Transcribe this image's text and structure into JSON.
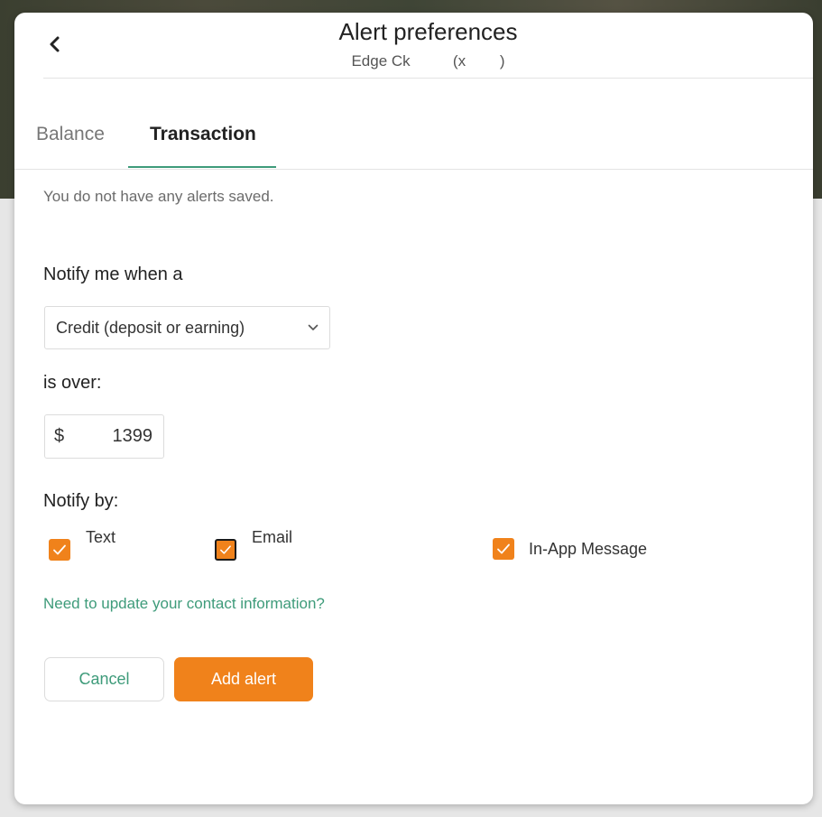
{
  "header": {
    "title": "Alert preferences",
    "account_name": "Edge Ck",
    "account_number": "(x        )"
  },
  "tabs": [
    {
      "label": "Balance",
      "active": false
    },
    {
      "label": "Transaction",
      "active": true
    }
  ],
  "alerts": {
    "empty_message": "You do not have any alerts saved."
  },
  "form": {
    "notify_label": "Notify me when a",
    "type_select": {
      "selected": "Credit (deposit or earning)"
    },
    "over_label": "is over:",
    "amount": {
      "currency": "$",
      "value": "1399"
    },
    "notify_by_label": "Notify by:",
    "channels": [
      {
        "label": "Text",
        "checked": true
      },
      {
        "label": "Email",
        "checked": true
      },
      {
        "label": "In-App Message",
        "checked": true
      }
    ],
    "contact_link": "Need to update your contact information?",
    "cancel_label": "Cancel",
    "add_label": "Add alert"
  },
  "colors": {
    "accent": "#f0821b",
    "link": "#3e9b7a",
    "tab_underline": "#3e9b7a"
  },
  "icons": {
    "back": "chevron-left-icon",
    "select": "chevron-down-icon",
    "check": "check-icon"
  }
}
